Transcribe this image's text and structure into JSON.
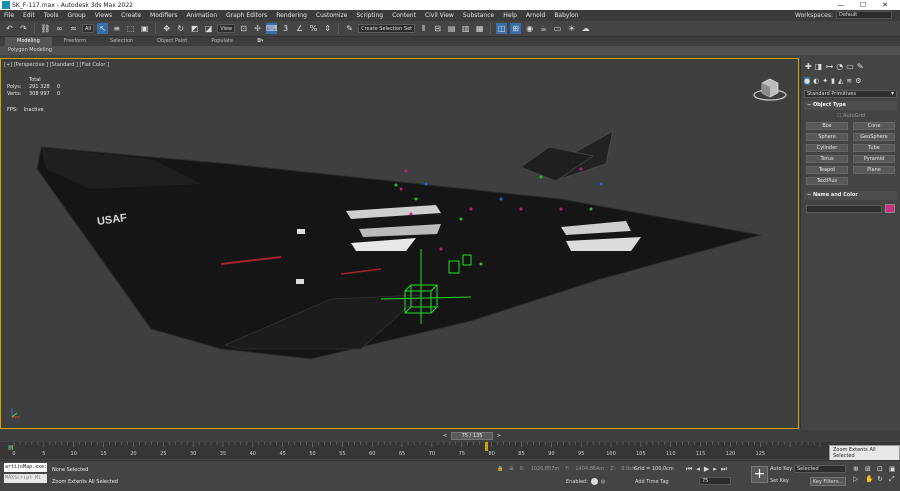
{
  "titlebar": {
    "title": "SK_F-117.max - Autodesk 3ds Max 2022",
    "minimize": "—",
    "maximize": "☐",
    "close": "✕"
  },
  "menu": [
    "File",
    "Edit",
    "Tools",
    "Group",
    "Views",
    "Create",
    "Modifiers",
    "Animation",
    "Graph Editors",
    "Rendering",
    "Customize",
    "Scripting",
    "Content",
    "Civil View",
    "Substance",
    "Help",
    "Arnold",
    "Babylon"
  ],
  "workspace": {
    "label": "Workspaces:",
    "value": "Default"
  },
  "toolbar": {
    "filter": "All",
    "ref_coord": "View",
    "selection_set": "Create Selection Set"
  },
  "ribbon": {
    "tabs": [
      "Modeling",
      "Freeform",
      "Selection",
      "Object Paint",
      "Populate"
    ],
    "active_tab": "Modeling",
    "panel": "Polygon Modeling"
  },
  "viewport": {
    "label": "[+] [Perspective ] [Standard ] [Flat Color ]",
    "stats": {
      "total_label": "Total",
      "polys_label": "Polys:",
      "polys_value": "291 328",
      "polys_sel": "0",
      "verts_label": "Verts:",
      "verts_value": "308 997",
      "verts_sel": "0"
    },
    "fps_label": "FPS:",
    "fps_value": "Inactive",
    "fuselage_marking": "USAF",
    "accent_color": "#c9a600"
  },
  "command_panel": {
    "category": "Standard Primitives",
    "object_type": {
      "title": "Object Type",
      "autogrid": "AutoGrid",
      "buttons": [
        "Box",
        "Cone",
        "Sphere",
        "GeoSphere",
        "Cylinder",
        "Tube",
        "Torus",
        "Pyramid",
        "Teapot",
        "Plane",
        "TextPlus"
      ]
    },
    "name_color": {
      "title": "Name and Color",
      "color": "#c8307e"
    }
  },
  "timeline": {
    "slider": "75 / 135",
    "ticks": [
      "0",
      "5",
      "10",
      "15",
      "20",
      "25",
      "30",
      "35",
      "40",
      "45",
      "50",
      "55",
      "60",
      "65",
      "70",
      "75",
      "80",
      "85",
      "90",
      "95",
      "100",
      "105",
      "110",
      "115",
      "120",
      "125"
    ]
  },
  "tooltip": "Zoom Extents All Selected",
  "status": {
    "maxscript_line1": "arti(oMap.exe:",
    "maxscript_line2": "MAXScript Mi",
    "selection": "None Selected",
    "prompt": "Zoom Extents All Selected",
    "x_label": "X:",
    "x_value": "1026.857m",
    "y_label": "Y:",
    "y_value": "1404.864m",
    "z_label": "Z:",
    "z_value": "0.0cm",
    "grid": "Grid = 100,0cm",
    "enabled": "Enabled:",
    "add_time_tag": "Add Time Tag",
    "frame": "75",
    "auto_key": "Auto Key",
    "set_key": "Set Key",
    "key_mode": "Selected",
    "key_filters": "Key Filters..."
  }
}
